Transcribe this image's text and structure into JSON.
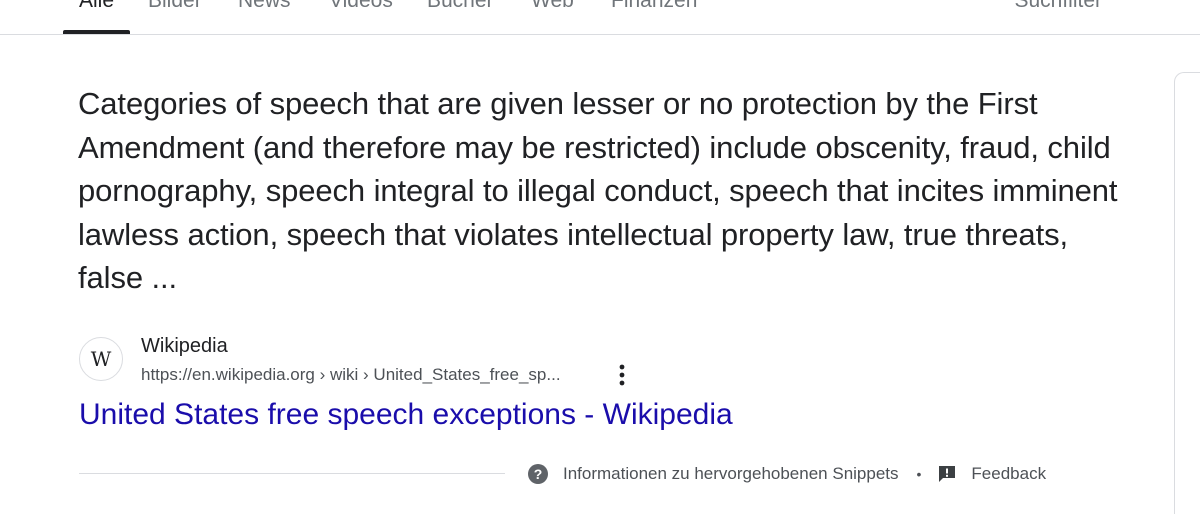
{
  "tabs": [
    {
      "label": "Alle",
      "active": true
    },
    {
      "label": "Bilder",
      "active": false
    },
    {
      "label": "News",
      "active": false
    },
    {
      "label": "Videos",
      "active": false
    },
    {
      "label": "Bücher",
      "active": false
    },
    {
      "label": "Web",
      "active": false
    },
    {
      "label": "Finanzen",
      "active": false
    }
  ],
  "tools_label": "Suchfilter",
  "snippet": {
    "text": "Categories of speech that are given lesser or no protection by the First Amendment (and therefore may be restricted) include obscenity, fraud, child pornography, speech integral to illegal conduct, speech that incites imminent lawless action, speech that violates intellectual property law, true threats, false ..."
  },
  "source": {
    "favicon_letter": "W",
    "site_name": "Wikipedia",
    "url": "https://en.wikipedia.org › wiki › United_States_free_sp...",
    "title": "United States free speech exceptions - Wikipedia"
  },
  "footer": {
    "help_icon": "help-circle-icon",
    "info_label": "Informationen zu hervorgehobenen Snippets",
    "separator": "•",
    "feedback_icon": "feedback-icon",
    "feedback_label": "Feedback"
  },
  "colors": {
    "link": "#1a0dab",
    "text": "#202124",
    "muted": "#70757a"
  }
}
